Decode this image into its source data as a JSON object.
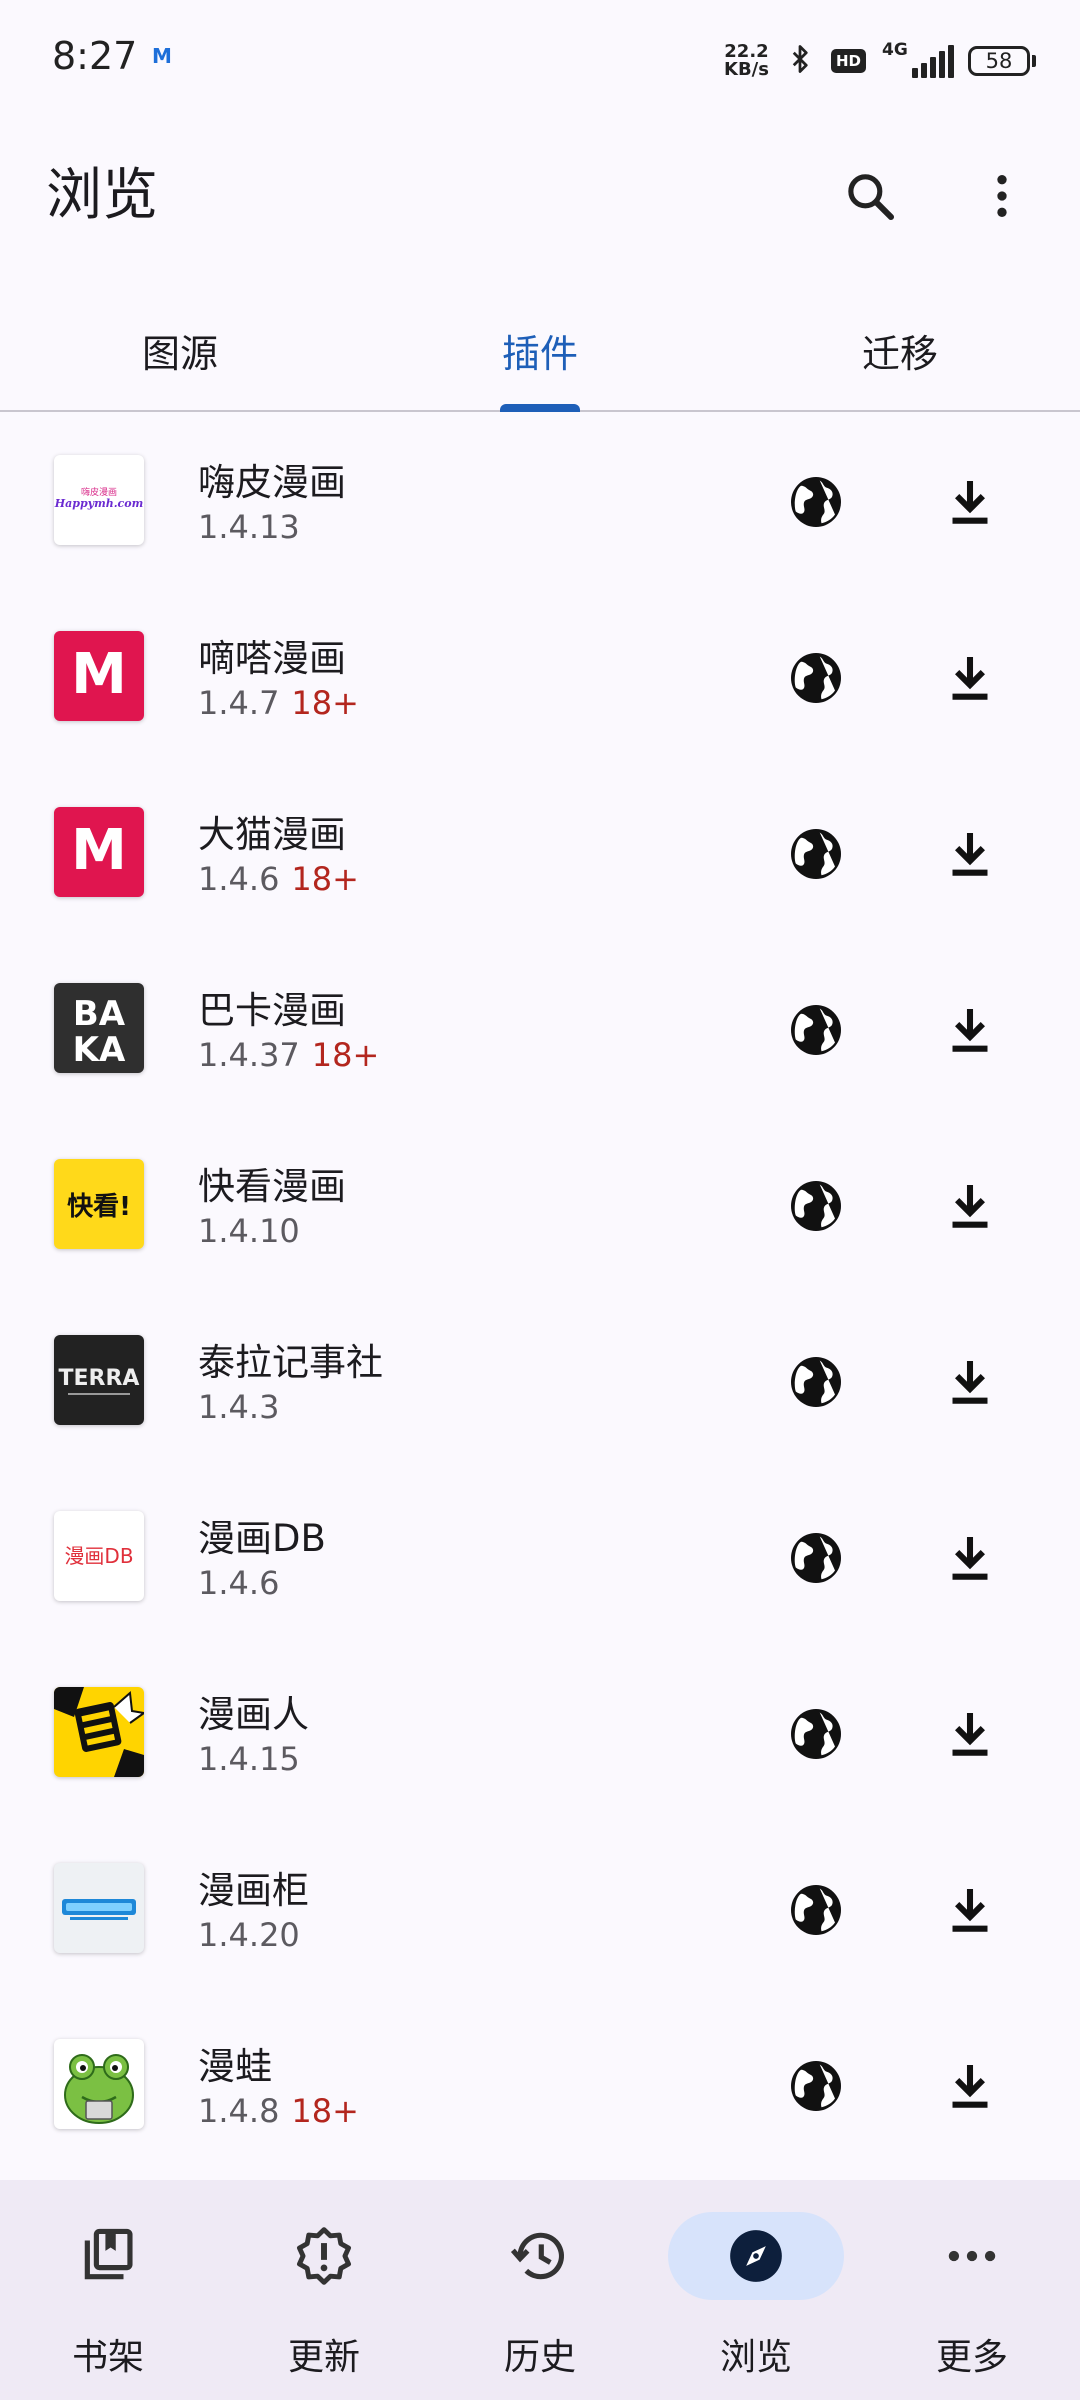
{
  "status_bar": {
    "time": "8:27",
    "notification": "M",
    "net_speed_value": "22.2",
    "net_speed_unit": "KB/s",
    "hd": "HD",
    "network": "4G",
    "battery": "58"
  },
  "app_bar": {
    "title": "浏览",
    "search_icon": "search-icon",
    "more_icon": "more-vert-icon"
  },
  "tabs": [
    {
      "label": "图源",
      "active": false
    },
    {
      "label": "插件",
      "active": true
    },
    {
      "label": "迁移",
      "active": false
    }
  ],
  "extensions": [
    {
      "name": "嗨皮漫画",
      "version": "1.4.13",
      "nsfw": "",
      "icon_text": "Happymh.com"
    },
    {
      "name": "嘀嗒漫画",
      "version": "1.4.7",
      "nsfw": "18+",
      "icon_text": "M"
    },
    {
      "name": "大猫漫画",
      "version": "1.4.6",
      "nsfw": "18+",
      "icon_text": "M"
    },
    {
      "name": "巴卡漫画",
      "version": "1.4.37",
      "nsfw": "18+",
      "icon_text": "BAKA"
    },
    {
      "name": "快看漫画",
      "version": "1.4.10",
      "nsfw": "",
      "icon_text": "快看!"
    },
    {
      "name": "泰拉记事社",
      "version": "1.4.3",
      "nsfw": "",
      "icon_text": "TERRA"
    },
    {
      "name": "漫画DB",
      "version": "1.4.6",
      "nsfw": "",
      "icon_text": "漫画DB"
    },
    {
      "name": "漫画人",
      "version": "1.4.15",
      "nsfw": "",
      "icon_text": ""
    },
    {
      "name": "漫画柜",
      "version": "1.4.20",
      "nsfw": "",
      "icon_text": ""
    },
    {
      "name": "漫蛙",
      "version": "1.4.8",
      "nsfw": "18+",
      "icon_text": ""
    }
  ],
  "row_actions": {
    "web_icon": "globe-icon",
    "install_icon": "download-icon"
  },
  "bottom_nav": [
    {
      "label": "书架",
      "icon": "library-icon",
      "active": false
    },
    {
      "label": "更新",
      "icon": "updates-alert-icon",
      "active": false
    },
    {
      "label": "历史",
      "icon": "history-icon",
      "active": false
    },
    {
      "label": "浏览",
      "icon": "compass-icon",
      "active": true
    },
    {
      "label": "更多",
      "icon": "more-horiz-icon",
      "active": false
    }
  ],
  "colors": {
    "accent": "#1e5fb8",
    "nsfw": "#b3261e",
    "nav_active_bg": "#d7e3fb",
    "nav_bg": "#efeaf5",
    "background": "#fbf9fe"
  }
}
